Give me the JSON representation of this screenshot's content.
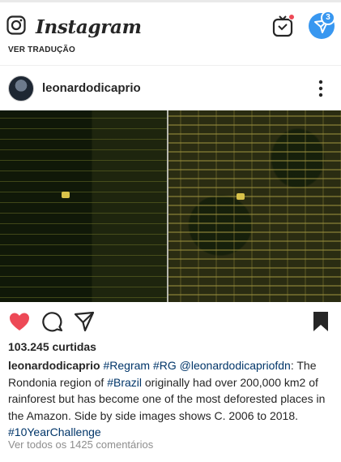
{
  "header": {
    "brand": "Instagram",
    "dm_badge_count": "3",
    "icons": [
      "camera-icon",
      "igtv-icon",
      "direct-message-icon"
    ],
    "colors": {
      "accent": "#3897f0",
      "notification": "#ed4956"
    }
  },
  "translate_label": "VER TRADUÇÃO",
  "post": {
    "username": "leonardodicaprio",
    "likes": "103.245 curtidas",
    "caption": {
      "username": "leonardodicaprio",
      "tag_regram": "#Regram",
      "tag_rg": "#RG",
      "mention": "@leonardodicapriofdn",
      "text_1": ": The Rondonia region of ",
      "tag_brazil": "#Brazil",
      "text_2": " originally had over 200,000 km2 of rainforest but has become one of the most deforested places in the Amazon. Side by side images shows C. 2006 to 2018. ",
      "tag_challenge": "#10YearChallenge"
    },
    "view_comments": "Ver todos os 1425 comentários",
    "liked": true,
    "saved": true
  }
}
